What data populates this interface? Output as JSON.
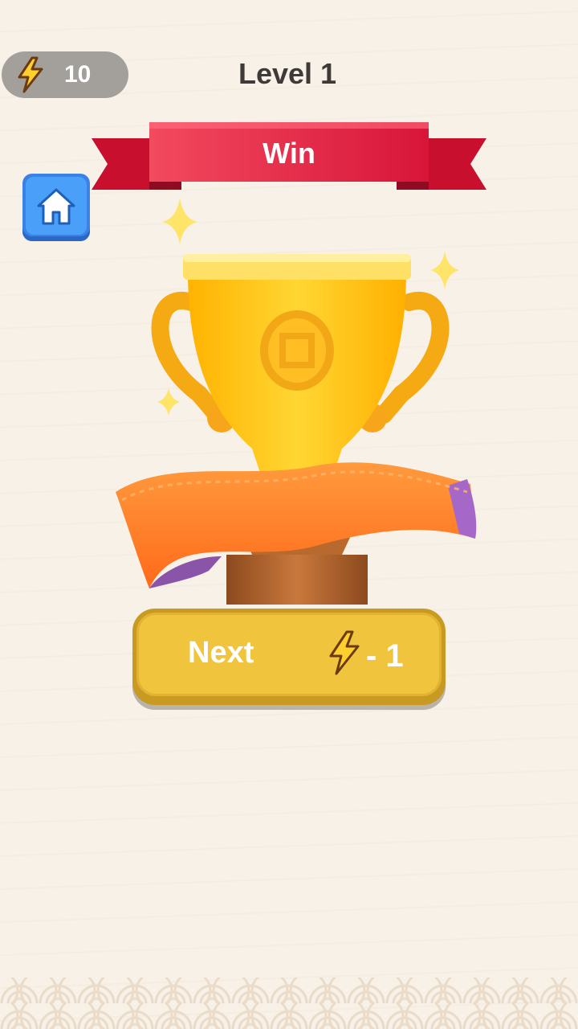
{
  "hud": {
    "energy_count": "10",
    "energy_icon": "lightning-bolt-icon",
    "level_title": "Level 1"
  },
  "banner": {
    "text": "Win"
  },
  "home_button": {
    "icon": "home-icon"
  },
  "trophy": {
    "icon": "trophy-icon"
  },
  "next_button": {
    "label": "Next",
    "cost_icon": "lightning-bolt-icon",
    "cost_text": "- 1"
  },
  "colors": {
    "background": "#f8f1e7",
    "banner_red": "#e8203f",
    "home_blue": "#4aa0f8",
    "button_gold": "#f0c43c",
    "ribbon_orange": "#ff7a2a",
    "trophy_gold": "#ffc21a"
  }
}
